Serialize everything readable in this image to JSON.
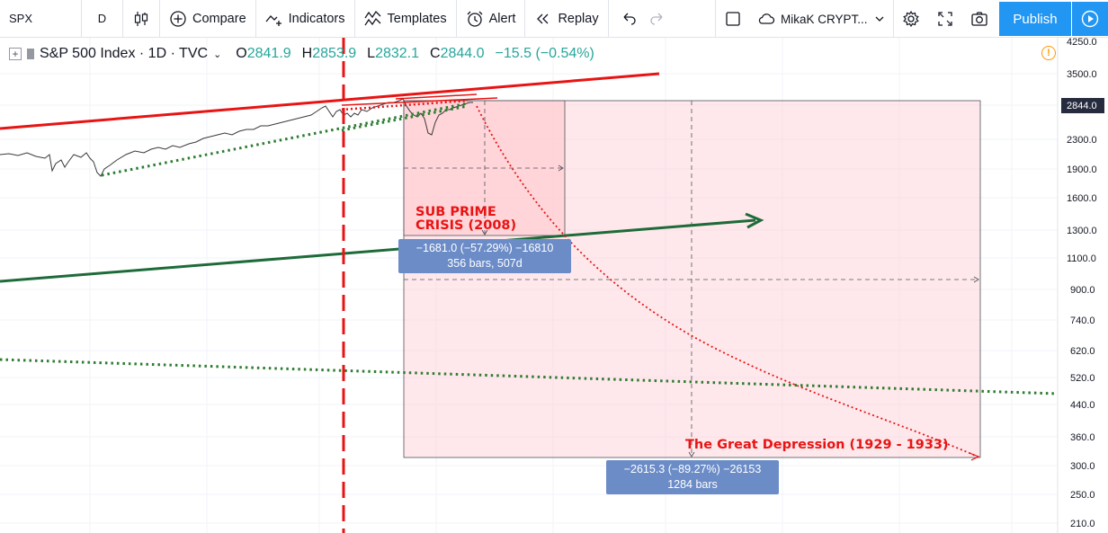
{
  "toolbar": {
    "symbol": "SPX",
    "interval": "D",
    "compare": "Compare",
    "indicators": "Indicators",
    "templates": "Templates",
    "alert": "Alert",
    "replay": "Replay",
    "layout_name": "MikaK CRYPT...",
    "publish": "Publish"
  },
  "legend": {
    "title": "S&P 500 Index · 1D · TVC",
    "open_label": "O",
    "open": "2841.9",
    "high_label": "H",
    "high": "2853.9",
    "low_label": "L",
    "low": "2832.1",
    "close_label": "C",
    "close": "2844.0",
    "change": "−15.5 (−0.54%)"
  },
  "price_axis": {
    "labels": [
      "4250.0",
      "3500.0",
      "2844.0",
      "2300.0",
      "1900.0",
      "1600.0",
      "1300.0",
      "1100.0",
      "900.0",
      "740.0",
      "620.0",
      "520.0",
      "440.0",
      "360.0",
      "300.0",
      "250.0",
      "210.0"
    ],
    "current_price": "2844.0"
  },
  "annotations": {
    "subprime": "SUB PRIME\nCRISIS (2008)",
    "depression": "The Great Depression (1929 - 1933)"
  },
  "measures": {
    "small_line1": "−1681.0 (−57.29%) −16810",
    "small_line2": "356 bars, 507d",
    "large_line1": "−2615.3 (−89.27%) −26153",
    "large_line2": "1284 bars"
  },
  "colors": {
    "red": "#e81414",
    "green": "#1e6b3a",
    "dotted_green": "#2e7d32",
    "box_fill": "#ffcdd2",
    "blue_label": "#6b8cc7",
    "publish": "#2196f3"
  }
}
